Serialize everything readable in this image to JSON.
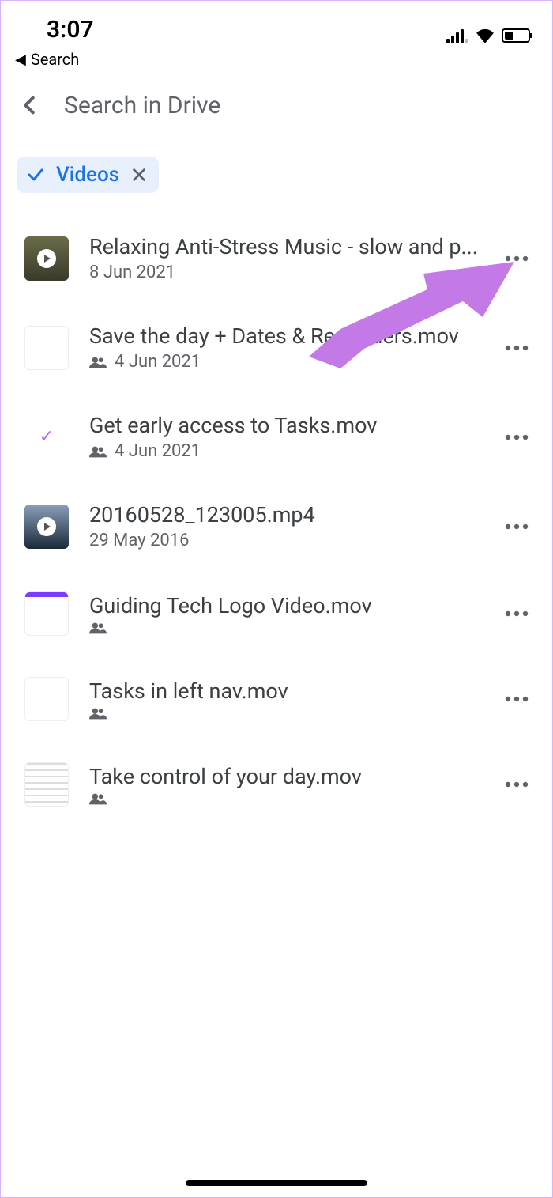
{
  "status_bar": {
    "time": "3:07"
  },
  "breadcrumb": {
    "label": "Search"
  },
  "search": {
    "placeholder": "Search in Drive"
  },
  "filter_chip": {
    "label": "Videos"
  },
  "files": [
    {
      "title": "Relaxing Anti-Stress Music - slow and p...",
      "date": "8 Jun 2021",
      "shared": false,
      "thumb": "video"
    },
    {
      "title": "Save the day + Dates & Reminders.mov",
      "date": "4 Jun 2021",
      "shared": true,
      "thumb": "mock1"
    },
    {
      "title": "Get early access to Tasks.mov",
      "date": "4 Jun 2021",
      "shared": true,
      "thumb": "check"
    },
    {
      "title": "20160528_123005.mp4",
      "date": "29 May 2016",
      "shared": false,
      "thumb": "video2"
    },
    {
      "title": "Guiding Tech Logo Video.mov",
      "date": "",
      "shared": true,
      "thumb": "logo"
    },
    {
      "title": "Tasks in left nav.mov",
      "date": "",
      "shared": true,
      "thumb": "doc"
    },
    {
      "title": "Take control of your day.mov",
      "date": "",
      "shared": true,
      "thumb": "doc-lines"
    }
  ],
  "annotation": {
    "arrow_color": "#c47ae6"
  }
}
